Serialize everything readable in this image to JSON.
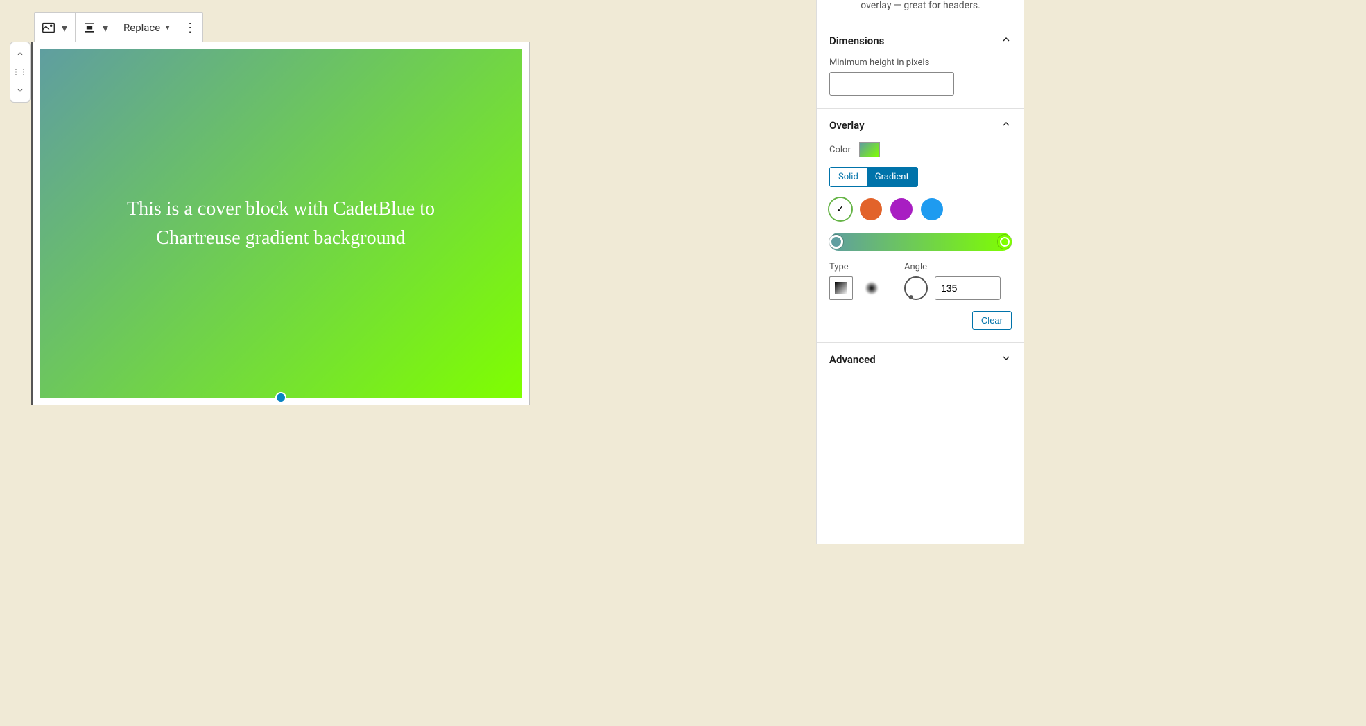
{
  "toolbar": {
    "replace_label": "Replace"
  },
  "cover": {
    "text": "This is a cover block with CadetBlue to Chartreuse gradient background",
    "gradient_start": "#5f9ea0",
    "gradient_end": "#7fff00",
    "gradient_angle": 135
  },
  "sidebar": {
    "description_tail": "overlay — great for headers.",
    "dimensions": {
      "title": "Dimensions",
      "min_height_label": "Minimum height in pixels",
      "min_height_value": ""
    },
    "overlay": {
      "title": "Overlay",
      "color_label": "Color",
      "seg_solid": "Solid",
      "seg_gradient": "Gradient",
      "presets": [
        {
          "name": "custom-selected",
          "color": "#ffffff",
          "selected": true
        },
        {
          "name": "orange",
          "color": "#e2632a"
        },
        {
          "name": "purple",
          "color": "#a81ec2"
        },
        {
          "name": "blue",
          "color": "#1e9bf0"
        }
      ],
      "type_label": "Type",
      "angle_label": "Angle",
      "angle_value": "135",
      "clear_label": "Clear"
    },
    "advanced": {
      "title": "Advanced"
    }
  }
}
